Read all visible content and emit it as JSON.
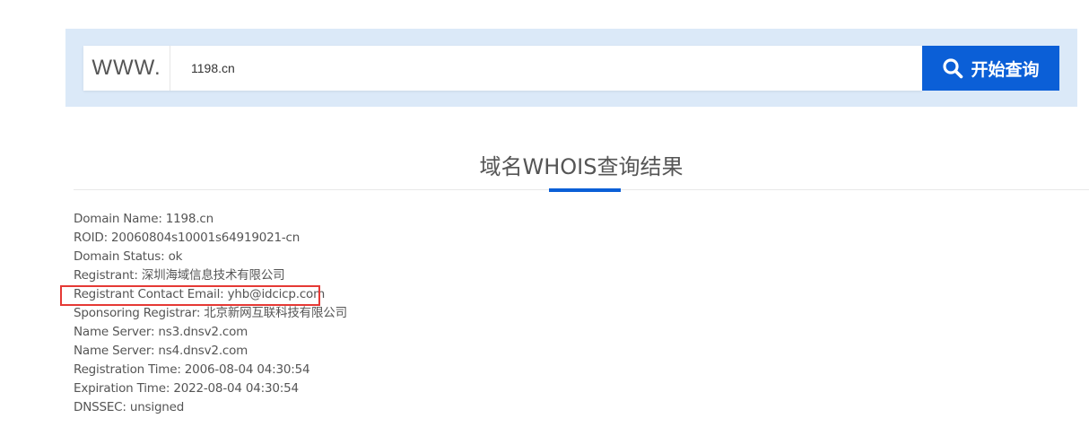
{
  "search": {
    "prefix": "WWW.",
    "value": "1198.cn",
    "button_label": "开始查询",
    "button_icon": "search-icon"
  },
  "result": {
    "title": "域名WHOIS查询结果"
  },
  "records": [
    {
      "label": "Domain Name",
      "value": "1198.cn"
    },
    {
      "label": "ROID",
      "value": "20060804s10001s64919021-cn"
    },
    {
      "label": "Domain Status",
      "value": "ok"
    },
    {
      "label": "Registrant",
      "value": "深圳海域信息技术有限公司"
    },
    {
      "label": "Registrant Contact Email",
      "value": "yhb@idcicp.com"
    },
    {
      "label": "Sponsoring Registrar",
      "value": "北京新网互联科技有限公司"
    },
    {
      "label": "Name Server",
      "value": "ns3.dnsv2.com"
    },
    {
      "label": "Name Server",
      "value": "ns4.dnsv2.com"
    },
    {
      "label": "Registration Time",
      "value": "2006-08-04 04:30:54"
    },
    {
      "label": "Expiration Time",
      "value": "2022-08-04 04:30:54"
    },
    {
      "label": "DNSSEC",
      "value": "unsigned"
    }
  ],
  "colors": {
    "accent": "#0b5fd7",
    "panel": "#dbe9f8",
    "highlight": "#e53935"
  }
}
